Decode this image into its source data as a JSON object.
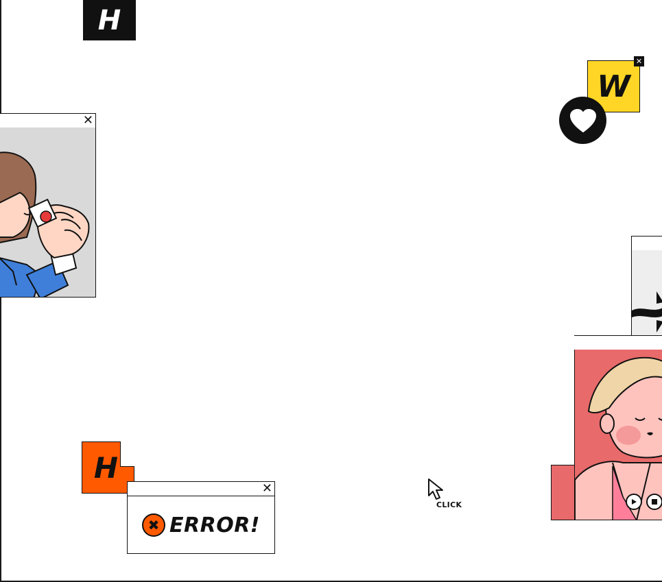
{
  "tiles": {
    "h_black": "H",
    "w_yellow": "W",
    "h_orange": "H"
  },
  "error_window": {
    "close_glyph": "✕",
    "badge_glyph": "✖",
    "message": "ERROR!"
  },
  "left_window": {
    "close_glyph": "✕"
  },
  "yellow_tile_close": "✕",
  "cursor_label": "CLICK",
  "colors": {
    "black": "#111111",
    "orange": "#ff5a00",
    "yellow": "#ffd626",
    "pink": "#e86a6a",
    "blue": "#3f7fd9",
    "gray": "#d9d9d9"
  },
  "icons": [
    "heart-icon",
    "close-icon",
    "cursor-icon",
    "play-icon",
    "stop-icon"
  ]
}
